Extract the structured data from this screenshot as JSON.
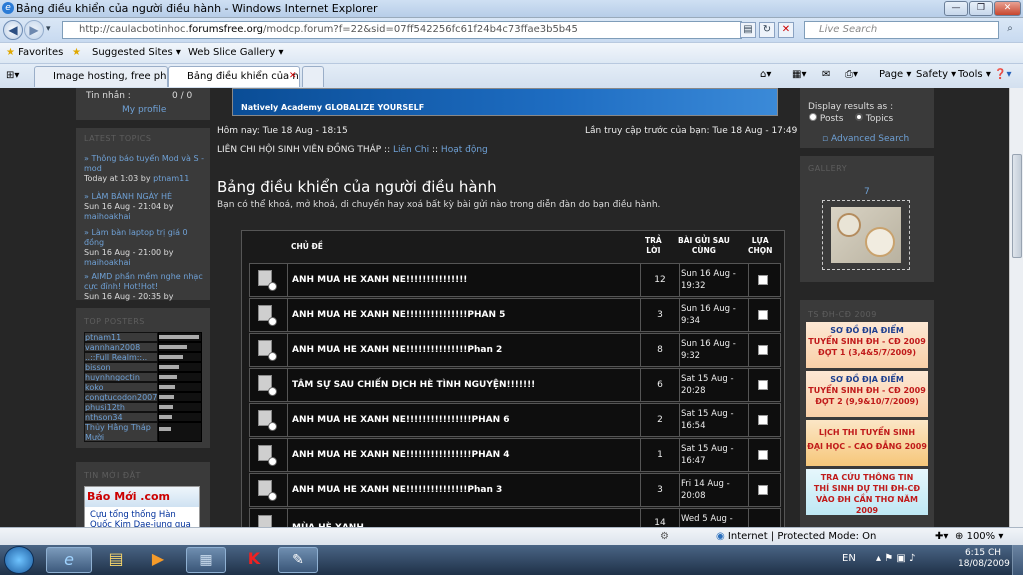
{
  "window": {
    "title": "Bảng điều khiển của người điều hành - Windows Internet Explorer",
    "ie_letter": "e"
  },
  "address": {
    "url_prefix": "http://caulacbotinhoc.",
    "url_domain": "forumsfree.org",
    "url_suffix": "/modcp.forum?f=22&sid=07ff542256fc61f24b4c73ffae3b5b45",
    "search_placeholder": "Live Search"
  },
  "favorites": {
    "label": "Favorites",
    "suggested": "Suggested Sites ▾",
    "webslice": "Web Slice Gallery ▾"
  },
  "tabs": [
    {
      "label": "Image hosting, free photo s..."
    },
    {
      "label": "Bảng điều khiển của ng..."
    }
  ],
  "tools": {
    "page": "Page ▾",
    "safety": "Safety ▾",
    "tools": "Tools ▾"
  },
  "left": {
    "messages_label": "Tin nhắn :",
    "messages_value": "0 / 0",
    "my_profile": "My profile",
    "latest_title": "LATEST TOPICS",
    "topics": [
      {
        "title": "» Thông báo tuyển Mod và S -mod",
        "date": "Today at 1:03 by",
        "user": "ptnam11"
      },
      {
        "title": "» LÀM BÁNH NGÀY HÈ",
        "date": "Sun 16 Aug - 21:04 by",
        "user": "maihoakhai"
      },
      {
        "title": "» Làm bàn laptop trị giá 0 đồng",
        "date": "Sun 16 Aug - 21:00 by",
        "user": "maihoakhai"
      },
      {
        "title": "» AIMD phần mềm nghe nhạc cực đỉnh! Hot!Hot!",
        "date": "Sun 16 Aug - 20:35 by",
        "user": ""
      }
    ],
    "posters_title": "TOP POSTERS",
    "posters": [
      "ptnam11",
      "vannhan2008",
      "..::Full Realm::..",
      "bisson",
      "huynhngoctin",
      "koko",
      "congtucodon2007",
      "phusi12th",
      "nthson34",
      "Thủy Hằng Tháp Mười"
    ],
    "news_title": "TIN MỚI ĐẶT",
    "news_logo": "Báo Mới .com",
    "news_text": "Cựu tổng thống Hàn Quốc Kim Dae-jung qua"
  },
  "main": {
    "banner_text": "Natively Academy GLOBALIZE YOURSELF",
    "now": "Hôm nay: Tue 18 Aug - 18:15",
    "last_visit": "Lần truy cập trước của bạn: Tue 18 Aug - 17:49",
    "breadcrumb_root": "LIÊN CHI HỘI SINH VIÊN ĐỒNG THÁP ::",
    "breadcrumb_mid": "Liên Chi",
    "breadcrumb_sep": "::",
    "breadcrumb_leaf": "Hoạt động",
    "heading": "Bảng điều khiển của người điều hành",
    "description": "Bạn có thể khoá, mở khoá, di chuyển hay xoá bất kỳ bài gửi nào trong diễn đàn do bạn điều hành.",
    "col_topic": "CHỦ ĐỀ",
    "col_replies_1": "TRẢ",
    "col_replies_2": "LỜI",
    "col_last_1": "BÀI GỬI SAU",
    "col_last_2": "CÙNG",
    "col_select_1": "LỰA",
    "col_select_2": "CHỌN",
    "rows": [
      {
        "title": "ANH MUA HE XANH NE!!!!!!!!!!!!!!!",
        "replies": "12",
        "last1": "Sun 16 Aug -",
        "last2": "19:32"
      },
      {
        "title": "ANH MUA HE XANH NE!!!!!!!!!!!!!!!PHAN 5",
        "replies": "3",
        "last1": "Sun 16 Aug -",
        "last2": "9:34"
      },
      {
        "title": "ANH MUA HE XANH NE!!!!!!!!!!!!!!!Phan 2",
        "replies": "8",
        "last1": "Sun 16 Aug -",
        "last2": "9:32"
      },
      {
        "title": "TÂM SỰ SAU CHIẾN DỊCH HÈ TÌNH NGUYỆN!!!!!!!",
        "replies": "6",
        "last1": "Sat 15 Aug -",
        "last2": "20:28"
      },
      {
        "title": "ANH MUA HE XANH NE!!!!!!!!!!!!!!!!PHAN 6",
        "replies": "2",
        "last1": "Sat 15 Aug -",
        "last2": "16:54"
      },
      {
        "title": "ANH MUA HE XANH NE!!!!!!!!!!!!!!!!PHAN 4",
        "replies": "1",
        "last1": "Sat 15 Aug -",
        "last2": "16:47"
      },
      {
        "title": "ANH MUA HE XANH NE!!!!!!!!!!!!!!!Phan 3",
        "replies": "3",
        "last1": "Fri 14 Aug -",
        "last2": "20:08"
      },
      {
        "title": "MÙA HÈ XANH",
        "replies": "14",
        "last1": "Wed 5 Aug -",
        "last2": ""
      }
    ]
  },
  "right": {
    "display_label": "Display results as :",
    "opt_posts": "Posts",
    "opt_topics": "Topics",
    "advanced": "Advanced Search",
    "gallery_title": "GALLERY",
    "gallery_count": "7",
    "ads_title": "TS ĐH-CĐ 2009",
    "ads": [
      {
        "l1": "SƠ ĐỒ ĐỊA ĐIỂM",
        "l2": "TUYỂN SINH ĐH - CĐ 2009",
        "l3": "ĐỢT 1 (3,4&5/7/2009)"
      },
      {
        "l1": "SƠ ĐỒ ĐỊA ĐIỂM",
        "l2": "TUYỂN SINH ĐH - CĐ 2009",
        "l3": "ĐỢT 2 (9,9&10/7/2009)"
      },
      {
        "l1": "LỊCH THI TUYỂN SINH",
        "l2": "ĐẠI HỌC - CAO ĐẲNG 2009",
        "l3": ""
      },
      {
        "l1": "TRA CỨU THÔNG TIN",
        "l2": "THÍ SINH DỰ THI ĐH-CĐ",
        "l3": "VÀO ĐH CẦN THƠ NĂM 2009"
      }
    ]
  },
  "status": {
    "zone": "Internet | Protected Mode: On",
    "zoom": "100%"
  },
  "taskbar": {
    "lang": "EN",
    "time": "6:15 CH",
    "date": "18/08/2009"
  }
}
